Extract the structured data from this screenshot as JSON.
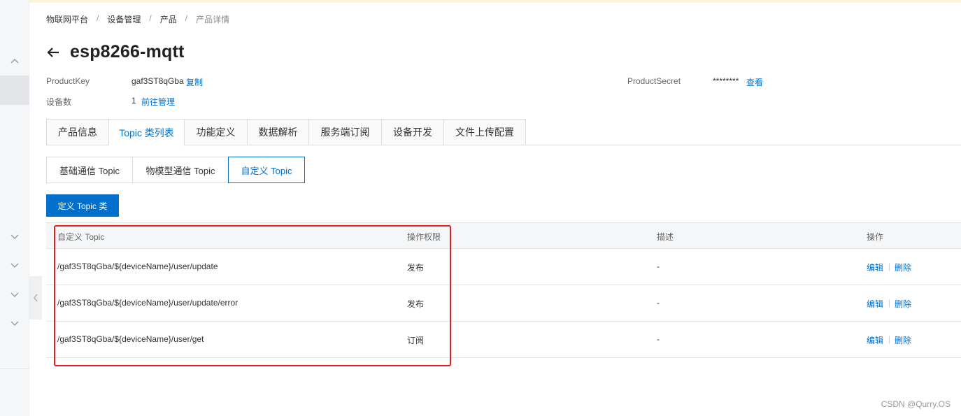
{
  "breadcrumb": [
    "物联网平台",
    "设备管理",
    "产品",
    "产品详情"
  ],
  "title": "esp8266-mqtt",
  "meta": {
    "product_key_label": "ProductKey",
    "product_key_value": "gaf3ST8qGba",
    "copy_label": "复制",
    "device_count_label": "设备数",
    "device_count_value": "1",
    "manage_label": "前往管理",
    "product_secret_label": "ProductSecret",
    "product_secret_value": "********",
    "view_label": "查看"
  },
  "tabs": [
    "产品信息",
    "Topic 类列表",
    "功能定义",
    "数据解析",
    "服务端订阅",
    "设备开发",
    "文件上传配置"
  ],
  "subtabs": [
    "基础通信 Topic",
    "物模型通信 Topic",
    "自定义 Topic"
  ],
  "primary_button": "定义 Topic 类",
  "table": {
    "headers": [
      "自定义 Topic",
      "操作权限",
      "描述",
      "操作"
    ],
    "rows": [
      {
        "topic": "/gaf3ST8qGba/${deviceName}/user/update",
        "permission": "发布",
        "description": "-",
        "edit": "编辑",
        "delete": "删除"
      },
      {
        "topic": "/gaf3ST8qGba/${deviceName}/user/update/error",
        "permission": "发布",
        "description": "-",
        "edit": "编辑",
        "delete": "删除"
      },
      {
        "topic": "/gaf3ST8qGba/${deviceName}/user/get",
        "permission": "订阅",
        "description": "-",
        "edit": "编辑",
        "delete": "删除"
      }
    ]
  },
  "watermark": "CSDN @Qurry.OS",
  "colors": {
    "accent": "#0070cc",
    "highlight": "#e02020"
  }
}
